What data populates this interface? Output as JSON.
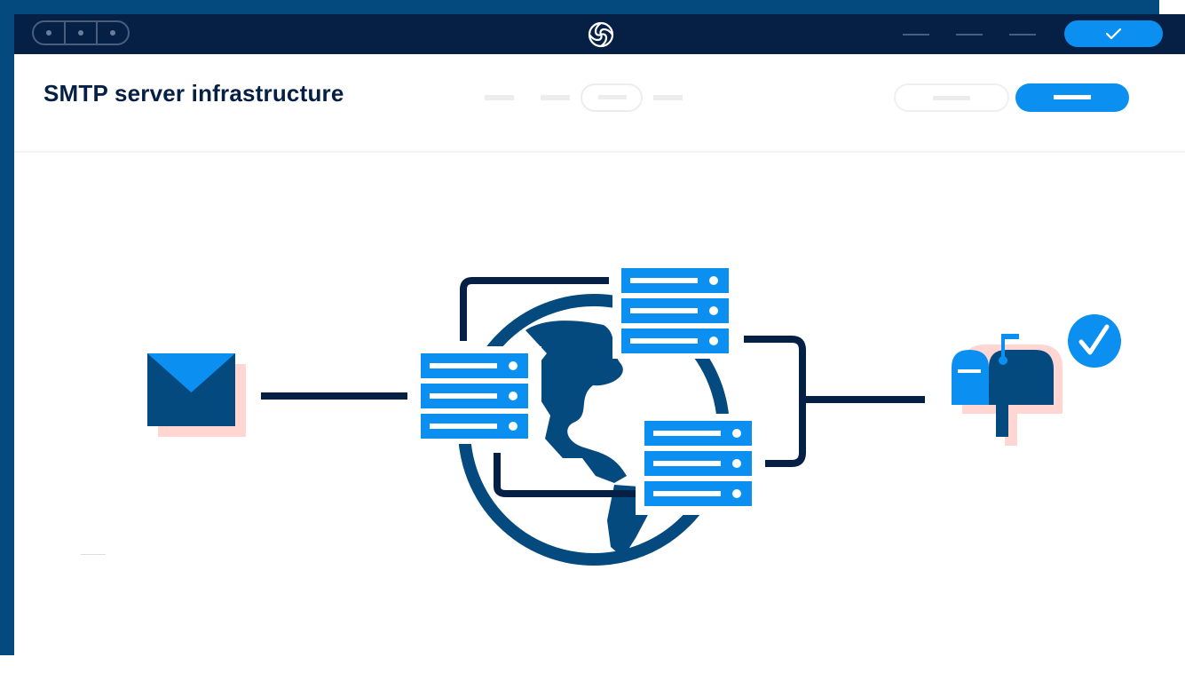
{
  "header": {
    "title": "SMTP server infrastructure"
  },
  "colors": {
    "navy": "#061f45",
    "brand_dark_blue": "#044a7e",
    "accent_blue": "#0b8ff0",
    "shadow_pink": "#ffd6d2",
    "placeholder_grey": "#ededed"
  },
  "icons": {
    "logo": "brand-swirl-logo",
    "top_action": "checkmark-icon",
    "sender": "envelope-icon",
    "network": "globe-icon",
    "servers": "server-rack-icon",
    "recipient": "mailbox-icon",
    "delivered": "check-circle-icon"
  }
}
